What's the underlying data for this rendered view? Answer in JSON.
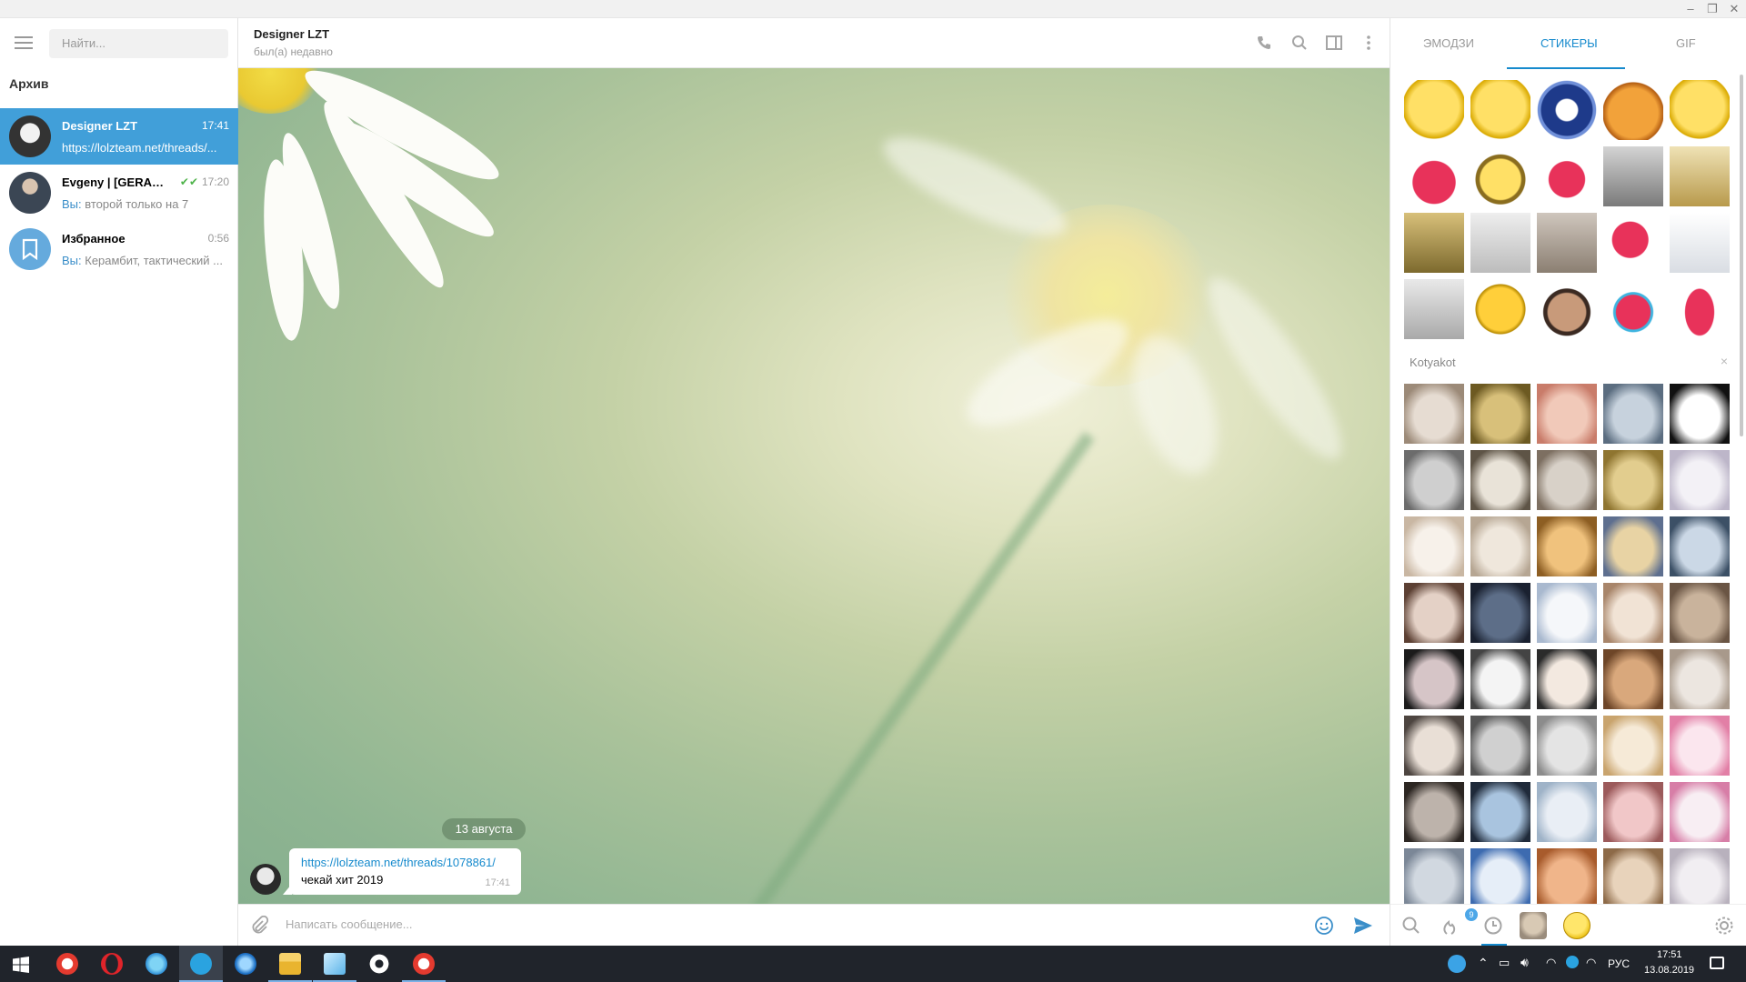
{
  "window": {
    "controls": [
      "–",
      "❐",
      "✕"
    ]
  },
  "sidebar": {
    "search_placeholder": "Найти...",
    "archive_label": "Архив",
    "dialogs": [
      {
        "name": "Designer LZT",
        "time": "17:41",
        "preview": "https://lolzteam.net/threads/...",
        "you_prefix": "",
        "active": true
      },
      {
        "name": "Evgeny | [GERALD-...",
        "time": "17:20",
        "preview": "второй только на 7",
        "you_prefix": "Вы: ",
        "active": false
      },
      {
        "name": "Избранное",
        "time": "0:56",
        "preview": "Керамбит, тактический ...",
        "you_prefix": "Вы: ",
        "active": false
      }
    ]
  },
  "chat": {
    "title": "Designer LZT",
    "status": "был(а) недавно",
    "date_label": "13 августа",
    "message": {
      "link": "https://lolzteam.net/threads/1078861/",
      "text": "чекай хит 2019",
      "time": "17:41"
    },
    "composer_placeholder": "Написать сообщение..."
  },
  "stickers_panel": {
    "tabs": [
      "ЭМОДЗИ",
      "СТИКЕРЫ",
      "GIF"
    ],
    "active_tab": "СТИКЕРЫ",
    "set_title": "Kotyakot",
    "set_close": "×",
    "footer_badge": "9",
    "accent_color": "#168acd"
  },
  "taskbar": {
    "language": "РУС",
    "time": "17:51",
    "date": "13.08.2019"
  }
}
